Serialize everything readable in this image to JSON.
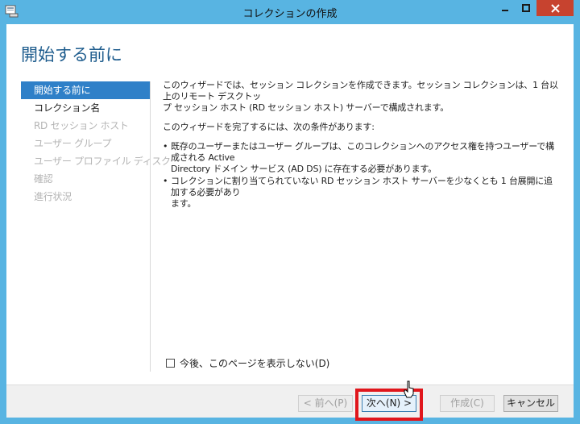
{
  "window": {
    "title": "コレクションの作成",
    "accent_color": "#58b4e2",
    "close_color": "#c7432f"
  },
  "header": {
    "title": "開始する前に"
  },
  "nav": {
    "items": [
      {
        "label": "開始する前に",
        "state": "active"
      },
      {
        "label": "コレクション名",
        "state": "enabled"
      },
      {
        "label": "RD セッション ホスト",
        "state": "disabled"
      },
      {
        "label": "ユーザー グループ",
        "state": "disabled"
      },
      {
        "label": "ユーザー プロファイル ディスク",
        "state": "disabled"
      },
      {
        "label": "確認",
        "state": "disabled"
      },
      {
        "label": "進行状況",
        "state": "disabled"
      }
    ]
  },
  "content": {
    "intro_line1": "このウィザードでは、セッション コレクションを作成できます。セッション コレクションは、1 台以上のリモート デスクトッ",
    "intro_line2": "プ セッション ホスト (RD セッション ホスト) サーバーで構成されます。",
    "prereq_heading": "このウィザードを完了するには、次の条件があります:",
    "bullets": [
      {
        "line1": "既存のユーザーまたはユーザー グループは、このコレクションへのアクセス権を持つユーザーで構成される Active",
        "line2": "Directory ドメイン サービス (AD DS) に存在する必要があります。"
      },
      {
        "line1": "コレクションに割り当てられていない RD セッション ホスト サーバーを少なくとも 1 台展開に追加する必要があり",
        "line2": "ます。"
      }
    ]
  },
  "checkbox": {
    "label": "今後、このページを表示しない(D)",
    "checked": false
  },
  "footer": {
    "prev_label": "< 前へ(P)",
    "next_label": "次へ(N) >",
    "create_label": "作成(C)",
    "cancel_label": "キャンセル"
  },
  "annotation": {
    "highlight_color": "#e0161c"
  }
}
